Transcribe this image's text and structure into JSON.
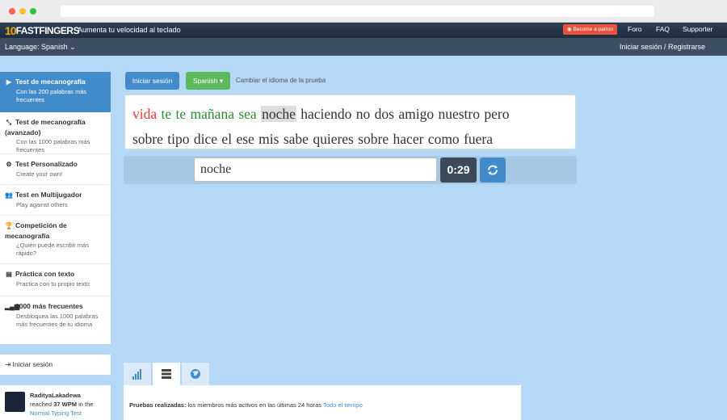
{
  "topnav": {
    "logo_num": "10",
    "logo_text": "FASTFINGERS",
    "tagline": "Aumenta tu velocidad al teclado",
    "patron": "Become a patron",
    "links": [
      "Foro",
      "FAQ",
      "Supporter"
    ]
  },
  "langbar": {
    "language": "Language: Spanish",
    "login_register": "Iniciar sesión / Registrarse"
  },
  "sidebar": {
    "items": [
      {
        "title": "Test de mecanografía",
        "sub": "Con las 200 palabras más frecuentes",
        "icon": "play-icon"
      },
      {
        "title": "Test de mecanografía (avanzado)",
        "sub": "Con las 1000 palabras más frecuentes",
        "icon": "expand-icon"
      },
      {
        "title": "Test Personalizado",
        "sub": "Create your own!",
        "icon": "cogs-icon"
      },
      {
        "title": "Test en Multijugador",
        "sub": "Play against others",
        "icon": "users-icon"
      },
      {
        "title": "Competición de mecanografía",
        "sub": "¿Quién puede escribir más rápido?",
        "icon": "trophy-icon"
      },
      {
        "title": "Práctica con texto",
        "sub": "Practica con tu propio texto",
        "icon": "file-icon"
      },
      {
        "title": "1000 más frecuentes",
        "sub": "Desbloquea las 1000 palabras más frecuentes de tu idioma",
        "icon": "signal-icon"
      }
    ],
    "login": "Iniciar sesión",
    "recent": {
      "user": "RadityaLakadewa",
      "reached": "reached",
      "wpm": "37 WPM",
      "in_the": "in the",
      "test": "Normal Typing Test"
    }
  },
  "toolbar": {
    "login_button": "Iniciar sesión",
    "language_button": "Spanish",
    "change_language": "Cambiar el idioma de la prueba"
  },
  "words": {
    "line1": [
      {
        "text": "vida",
        "state": "wrong"
      },
      {
        "text": "te",
        "state": "correct"
      },
      {
        "text": "te",
        "state": "correct"
      },
      {
        "text": "mañana",
        "state": "correct"
      },
      {
        "text": "sea",
        "state": "correct"
      },
      {
        "text": "noche",
        "state": "current"
      },
      {
        "text": "haciendo",
        "state": "pending"
      },
      {
        "text": "no",
        "state": "pending"
      },
      {
        "text": "dos",
        "state": "pending"
      },
      {
        "text": "amigo",
        "state": "pending"
      },
      {
        "text": "nuestro",
        "state": "pending"
      },
      {
        "text": "pero",
        "state": "pending"
      }
    ],
    "line2": [
      {
        "text": "sobre",
        "state": "pending"
      },
      {
        "text": "tipo",
        "state": "pending"
      },
      {
        "text": "dice",
        "state": "pending"
      },
      {
        "text": "el",
        "state": "pending"
      },
      {
        "text": "ese",
        "state": "pending"
      },
      {
        "text": "mis",
        "state": "pending"
      },
      {
        "text": "sabe",
        "state": "pending"
      },
      {
        "text": "quieres",
        "state": "pending"
      },
      {
        "text": "sobre",
        "state": "pending"
      },
      {
        "text": "hacer",
        "state": "pending"
      },
      {
        "text": "como",
        "state": "pending"
      },
      {
        "text": "fuera",
        "state": "pending"
      }
    ]
  },
  "input": {
    "value": "noche"
  },
  "timer": "0:29",
  "stats": {
    "tabs": [
      "signal-icon",
      "list-icon",
      "globe-icon"
    ],
    "label": "Pruebas realizadas:",
    "text": "los miembros más activos en las últimas 24 horas",
    "link": "Todo el tiempo"
  },
  "colors": {
    "background": "#b6d8f7",
    "primary": "#428bca",
    "success": "#5cb85c",
    "wrong": "#e53935",
    "correct": "#2e8b2e"
  }
}
